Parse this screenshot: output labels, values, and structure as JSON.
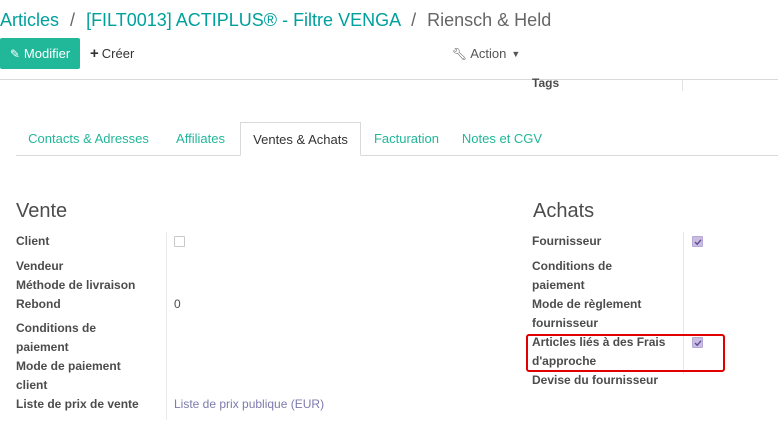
{
  "breadcrumb": {
    "articles": "Articles",
    "sep": "/",
    "product": "[FILT0013] ACTIPLUS® - Filtre VENGA",
    "current": "Riensch & Held"
  },
  "toolbar": {
    "edit_label": "Modifier",
    "create_label": "Créer",
    "action_label": "Action"
  },
  "header_fields": {
    "tags_label": "Tags"
  },
  "tabs": [
    {
      "label": "Contacts & Adresses"
    },
    {
      "label": "Affiliates"
    },
    {
      "label": "Ventes & Achats",
      "active": true
    },
    {
      "label": "Facturation"
    },
    {
      "label": "Notes et CGV"
    }
  ],
  "vente": {
    "title": "Vente",
    "client_label": "Client",
    "client_checked": false,
    "vendeur_label": "Vendeur",
    "methode_label": "Méthode de livraison",
    "rebond_label": "Rebond",
    "rebond_value": "0",
    "conditions_label_1": "Conditions de",
    "conditions_label_2": "paiement",
    "mode_label_1": "Mode de paiement",
    "mode_label_2": "client",
    "liste_label": "Liste de prix de vente",
    "liste_value": "Liste de prix publique (EUR)"
  },
  "achats": {
    "title": "Achats",
    "fournisseur_label": "Fournisseur",
    "fournisseur_checked": true,
    "conditions_label_1": "Conditions de",
    "conditions_label_2": "paiement",
    "mode_label_1": "Mode de règlement",
    "mode_label_2": "fournisseur",
    "articles_label_1": "Articles liés à des Frais",
    "articles_label_2": "d'approche",
    "articles_checked": true,
    "devise_label": "Devise du fournisseur"
  },
  "colors": {
    "brand_green": "#21b799",
    "link_purple": "#7c7bad",
    "highlight_red": "#e00000"
  }
}
